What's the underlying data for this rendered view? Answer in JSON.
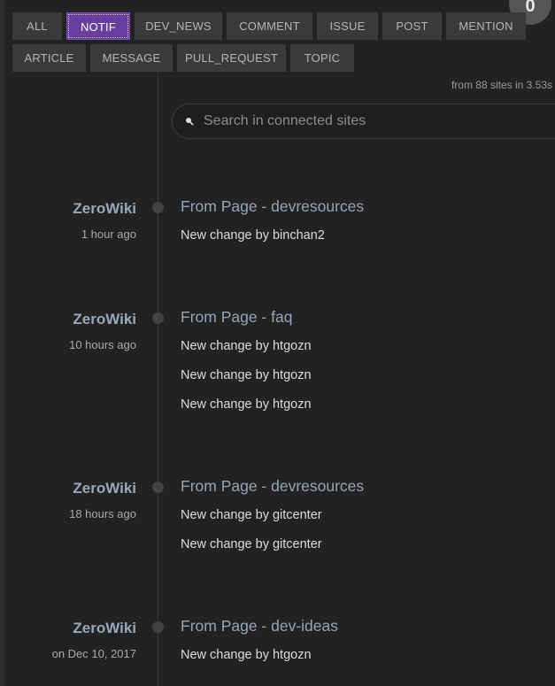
{
  "filters": [
    "ALL",
    "NOTIF",
    "DEV_NEWS",
    "COMMENT",
    "ISSUE",
    "POST",
    "MENTION",
    "ARTICLE",
    "MESSAGE",
    "PULL_REQUEST",
    "TOPIC"
  ],
  "active_filter": "NOTIF",
  "badge": "0",
  "stats": "from 88 sites in 3.53s",
  "search": {
    "placeholder": "Search in connected sites",
    "value": ""
  },
  "entries": [
    {
      "site": "ZeroWiki",
      "time": "1 hour ago",
      "title": "From Page - devresources",
      "lines": [
        "New change by binchan2"
      ]
    },
    {
      "site": "ZeroWiki",
      "time": "10 hours ago",
      "title": "From Page - faq",
      "lines": [
        "New change by htgozn",
        "New change by htgozn",
        "New change by htgozn"
      ]
    },
    {
      "site": "ZeroWiki",
      "time": "18 hours ago",
      "title": "From Page - devresources",
      "lines": [
        "New change by gitcenter",
        "New change by gitcenter"
      ]
    },
    {
      "site": "ZeroWiki",
      "time": "on Dec 10, 2017",
      "title": "From Page - dev-ideas",
      "lines": [
        "New change by htgozn"
      ]
    }
  ],
  "colors": {
    "active_filter": "#6a3ea1",
    "site_name": "#9aa8bc",
    "title": "#95a5b8"
  }
}
